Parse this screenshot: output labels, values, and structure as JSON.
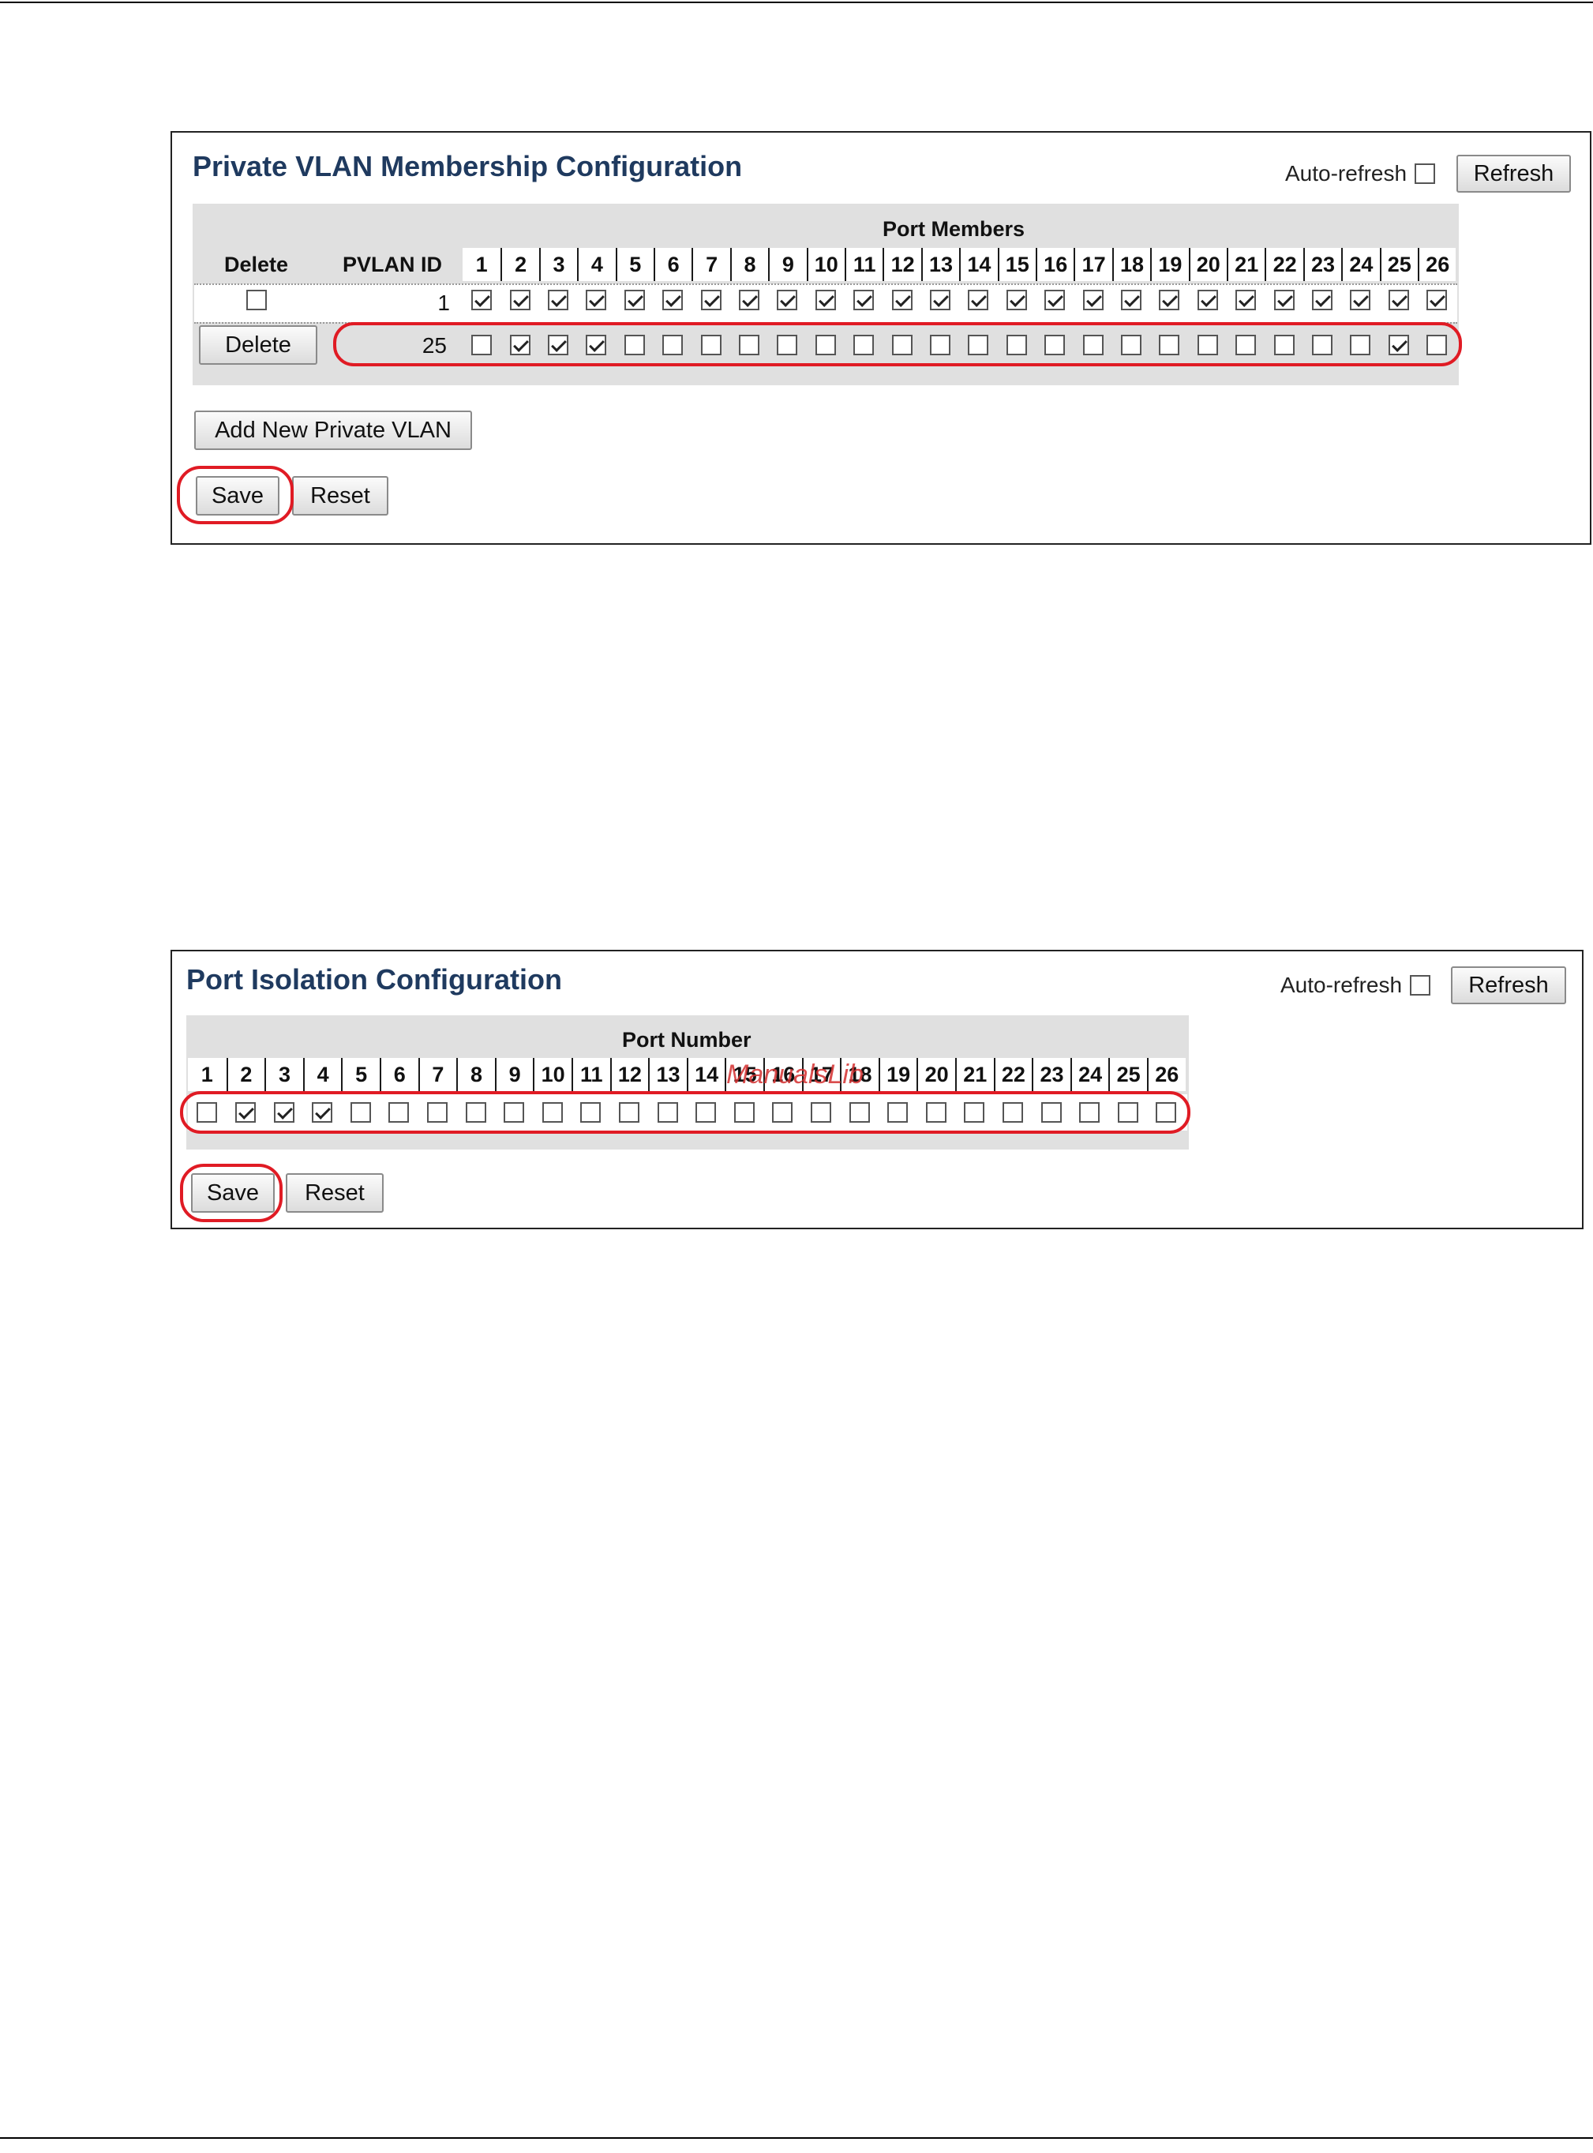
{
  "pvlan": {
    "title": "Private VLAN Membership Configuration",
    "auto_refresh_label": "Auto-refresh",
    "auto_refresh_checked": false,
    "refresh_label": "Refresh",
    "header": {
      "delete": "Delete",
      "pvlan_id": "PVLAN ID",
      "port_members": "Port Members"
    },
    "ports": [
      "1",
      "2",
      "3",
      "4",
      "5",
      "6",
      "7",
      "8",
      "9",
      "10",
      "11",
      "12",
      "13",
      "14",
      "15",
      "16",
      "17",
      "18",
      "19",
      "20",
      "21",
      "22",
      "23",
      "24",
      "25",
      "26"
    ],
    "rows": [
      {
        "delete_type": "checkbox",
        "delete_checked": false,
        "pvlan_id": "1",
        "members": [
          true,
          true,
          true,
          true,
          true,
          true,
          true,
          true,
          true,
          true,
          true,
          true,
          true,
          true,
          true,
          true,
          true,
          true,
          true,
          true,
          true,
          true,
          true,
          true,
          true,
          true
        ]
      },
      {
        "delete_type": "button",
        "delete_label": "Delete",
        "pvlan_id": "25",
        "members": [
          false,
          true,
          true,
          true,
          false,
          false,
          false,
          false,
          false,
          false,
          false,
          false,
          false,
          false,
          false,
          false,
          false,
          false,
          false,
          false,
          false,
          false,
          false,
          false,
          true,
          false
        ]
      }
    ],
    "add_label": "Add New Private VLAN",
    "save_label": "Save",
    "reset_label": "Reset"
  },
  "isolation": {
    "title": "Port Isolation Configuration",
    "auto_refresh_label": "Auto-refresh",
    "auto_refresh_checked": false,
    "refresh_label": "Refresh",
    "header": {
      "port_number": "Port Number"
    },
    "ports": [
      "1",
      "2",
      "3",
      "4",
      "5",
      "6",
      "7",
      "8",
      "9",
      "10",
      "11",
      "12",
      "13",
      "14",
      "15",
      "16",
      "17",
      "18",
      "19",
      "20",
      "21",
      "22",
      "23",
      "24",
      "25",
      "26"
    ],
    "members": [
      false,
      true,
      true,
      true,
      false,
      false,
      false,
      false,
      false,
      false,
      false,
      false,
      false,
      false,
      false,
      false,
      false,
      false,
      false,
      false,
      false,
      false,
      false,
      false,
      false,
      false
    ],
    "save_label": "Save",
    "reset_label": "Reset"
  },
  "watermark": "ManualsLib"
}
